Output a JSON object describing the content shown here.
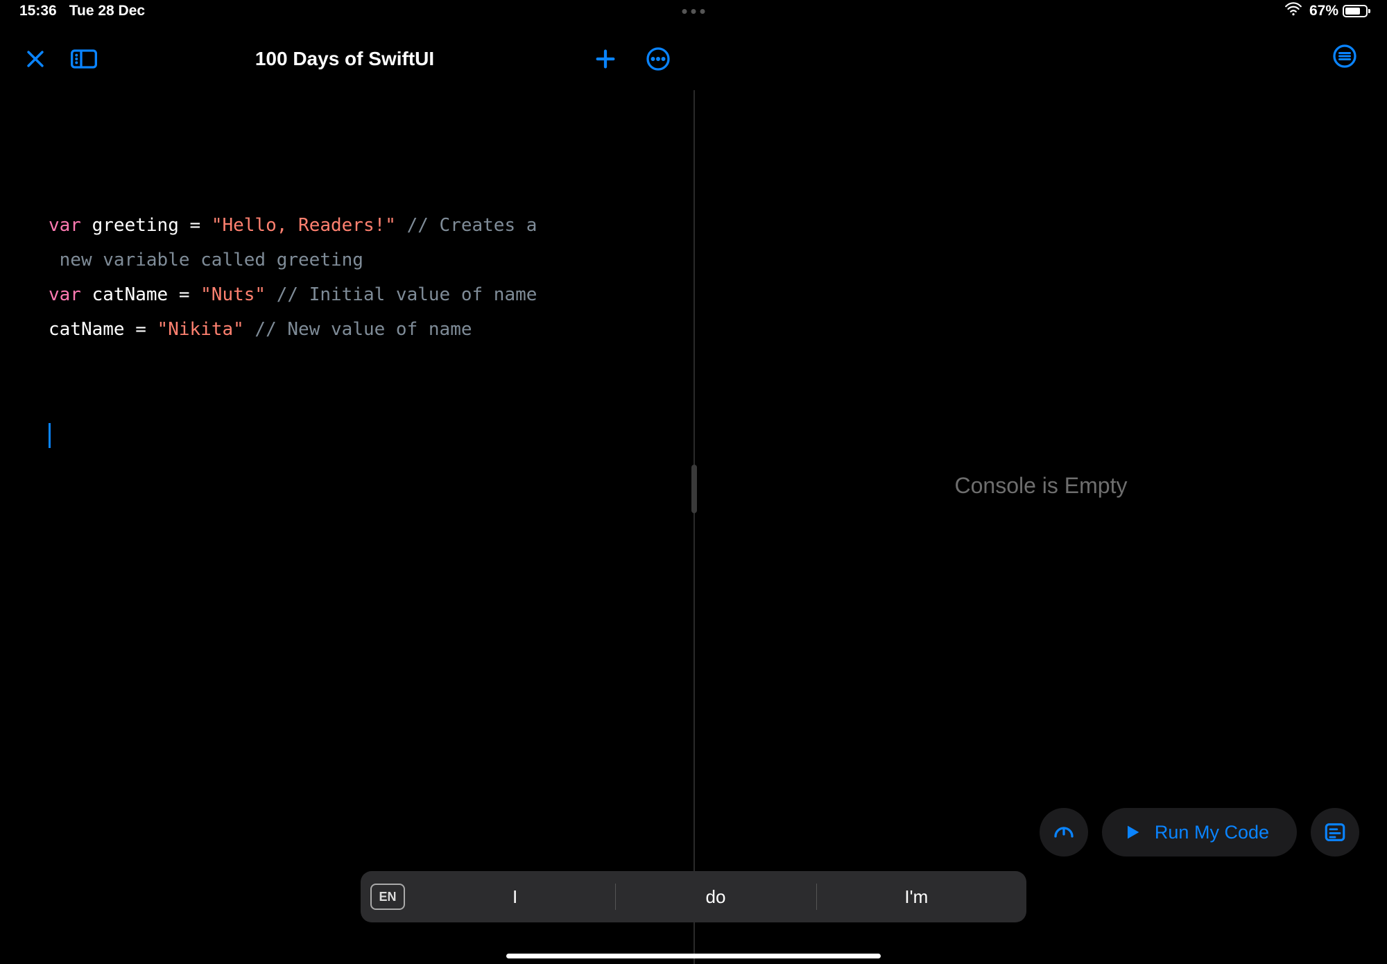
{
  "status": {
    "time": "15:36",
    "date": "Tue 28 Dec",
    "battery_percent": "67%",
    "battery_fill_pct": 67
  },
  "toolbar": {
    "title": "100 Days of SwiftUI"
  },
  "code": {
    "line1": {
      "kw": "var",
      "ident": " greeting = ",
      "str": "\"Hello, Readers!\"",
      "cmt": " // Creates a"
    },
    "line1b": {
      "cmt": " new variable called greeting"
    },
    "line2": {
      "kw": "var",
      "ident": " catName = ",
      "str": "\"Nuts\"",
      "cmt": " // Initial value of name"
    },
    "line3": {
      "ident": "catName = ",
      "str": "\"Nikita\"",
      "cmt": " // New value of name"
    }
  },
  "console": {
    "empty_text": "Console is Empty"
  },
  "run": {
    "label": "Run My Code"
  },
  "keyboard": {
    "lang": "EN",
    "suggestions": [
      "I",
      "do",
      "I'm"
    ]
  }
}
